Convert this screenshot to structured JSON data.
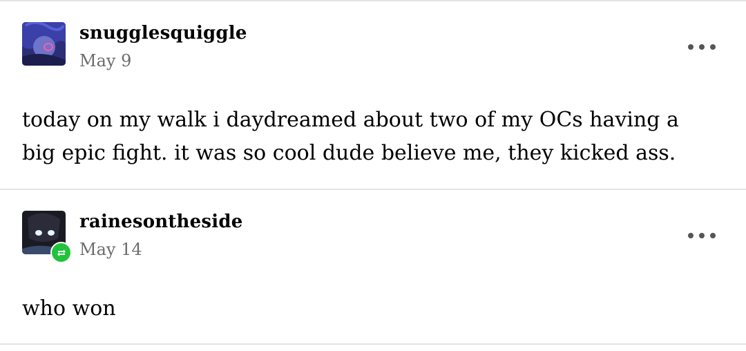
{
  "posts": [
    {
      "username": "snugglesquiggle",
      "date": "May 9",
      "text": "today on my walk i daydreamed about two of my OCs having a big epic fight.  it was so cool dude believe me, they kicked ass.",
      "avatar_icon": "avatar-purple-character"
    },
    {
      "username": "rainesontheside",
      "date": "May 14",
      "text": "who won",
      "avatar_icon": "avatar-dark-character",
      "badge_icon": "reblog-icon",
      "badge_color": "#20c33a"
    }
  ]
}
